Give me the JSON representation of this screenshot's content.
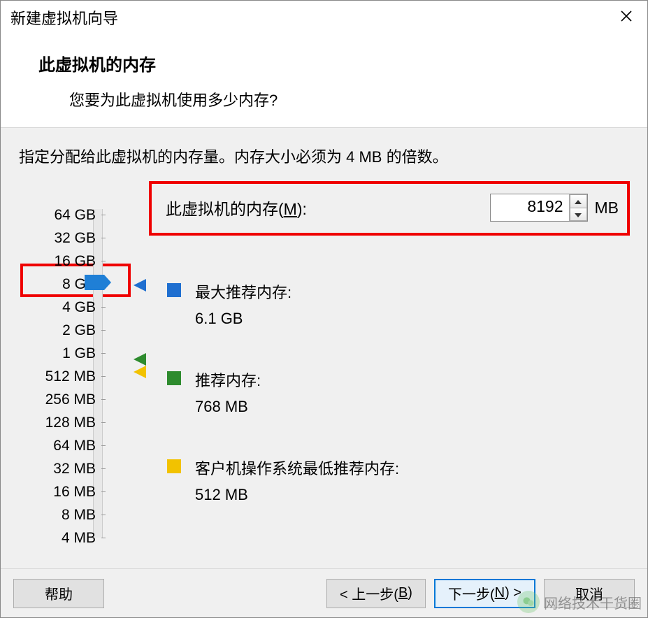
{
  "window": {
    "title": "新建虚拟机向导"
  },
  "header": {
    "title": "此虚拟机的内存",
    "subtitle": "您要为此虚拟机使用多少内存?"
  },
  "body": {
    "hint": "指定分配给此虚拟机的内存量。内存大小必须为 4 MB 的倍数。",
    "memory_label_prefix": "此虚拟机的内存(",
    "memory_label_mnemonic": "M",
    "memory_label_suffix": "):",
    "memory_value": "8192",
    "memory_unit": "MB",
    "ticks": [
      "64 GB",
      "32 GB",
      "16 GB",
      "8 GB",
      "4 GB",
      "2 GB",
      "1 GB",
      "512 MB",
      "256 MB",
      "128 MB",
      "64 MB",
      "32 MB",
      "16 MB",
      "8 MB",
      "4 MB"
    ],
    "legend": [
      {
        "color": "#1f6fd0",
        "label": "最大推荐内存:",
        "value": "6.1 GB"
      },
      {
        "color": "#2e8b2e",
        "label": "推荐内存:",
        "value": "768 MB"
      },
      {
        "color": "#f2c200",
        "label": "客户机操作系统最低推荐内存:",
        "value": "512 MB"
      }
    ],
    "markers": {
      "max_recommended_color": "#1f6fd0",
      "recommended_color": "#2e8b2e",
      "minimum_color": "#f2c200"
    }
  },
  "footer": {
    "help": "帮助",
    "back_prefix": "< 上一步(",
    "back_mnemonic": "B",
    "back_suffix": ")",
    "next_prefix": "下一步(",
    "next_mnemonic": "N",
    "next_suffix": ") >",
    "cancel": "取消"
  },
  "watermark": {
    "text": "网络技术干货圈"
  }
}
